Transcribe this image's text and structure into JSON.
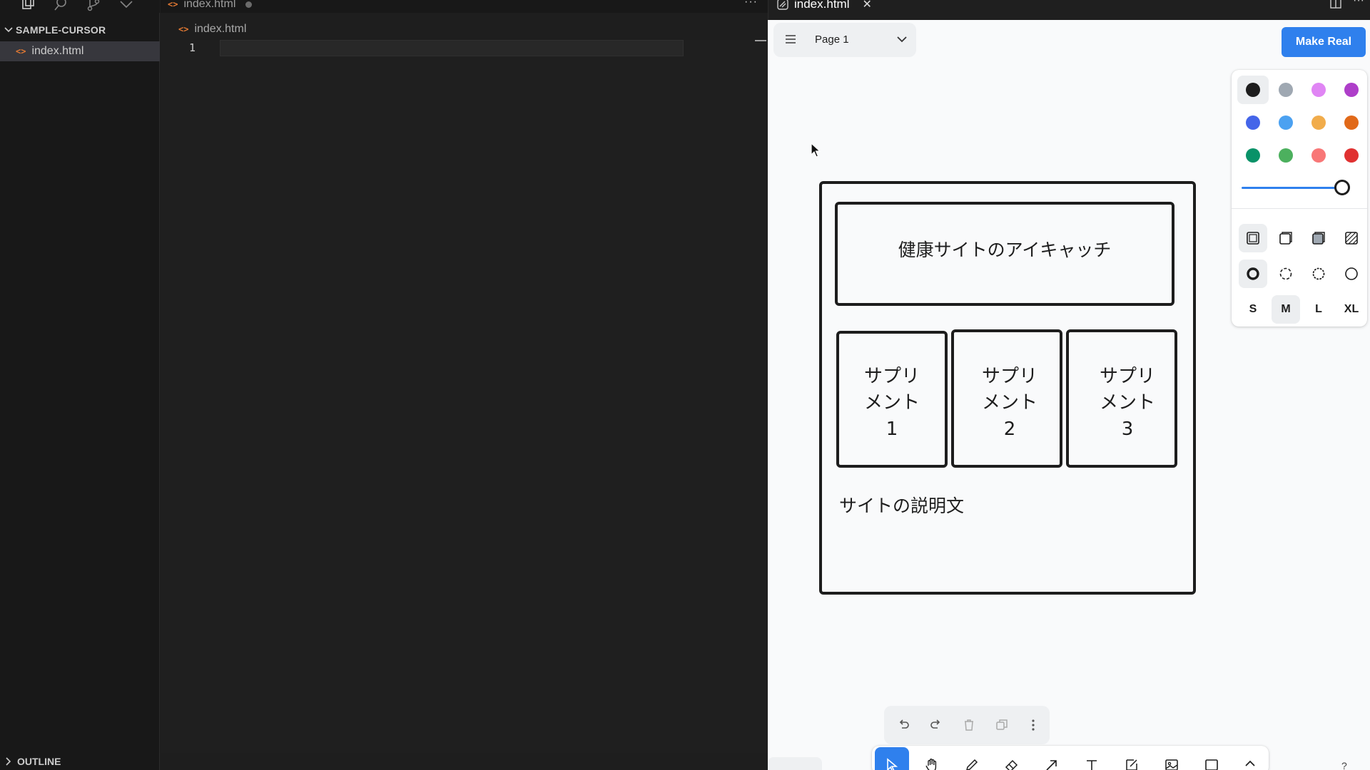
{
  "vscode": {
    "explorer": {
      "title": "SAMPLE-CURSOR",
      "files": [
        {
          "name": "index.html"
        }
      ],
      "outline_label": "OUTLINE"
    },
    "editor": {
      "tab_label": "index.html",
      "breadcrumb_file": "index.html",
      "line_number": "1"
    }
  },
  "webview": {
    "tab_label": "index.html"
  },
  "tldraw": {
    "page_name": "Page 1",
    "make_real_label": "Make Real",
    "colors": [
      "#1d1d1d",
      "#9fa8b2",
      "#e085f4",
      "#ae3ec9",
      "#4465e9",
      "#4ba1f1",
      "#f1ac4b",
      "#e16919",
      "#099268",
      "#4cb05e",
      "#f87777",
      "#e03131"
    ],
    "opacity": 1.0,
    "sizes": [
      "S",
      "M",
      "L",
      "XL"
    ],
    "selected_size": "M",
    "wireframe": {
      "hero": "健康サイトのアイキャッチ",
      "cards": [
        "サプリ\nメント\n1",
        "サプリ\nメント\n2",
        "サプリ\nメント\n3"
      ],
      "description": "サイトの説明文"
    }
  }
}
